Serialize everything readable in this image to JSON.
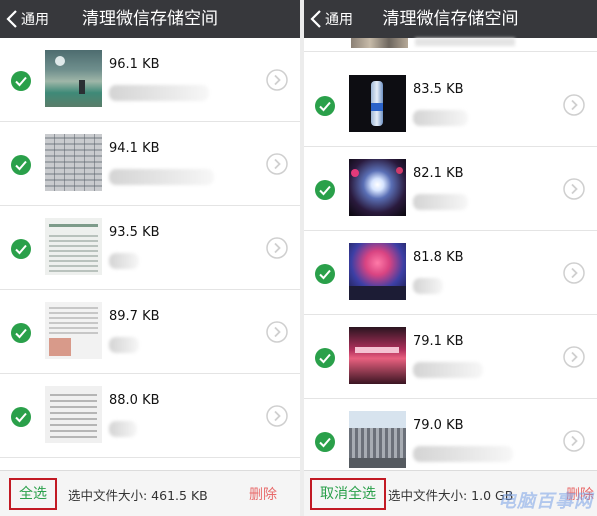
{
  "colors": {
    "header_bg": "#37383c",
    "check_green": "#2aa04a",
    "delete_red": "#e86a6a",
    "highlight_border": "#c21a24"
  },
  "left": {
    "back_label": "通用",
    "title": "清理微信存储空间",
    "items": [
      {
        "size": "96.1 KB",
        "icon": "check-circle-icon"
      },
      {
        "size": "94.1 KB",
        "icon": "check-circle-icon"
      },
      {
        "size": "93.5 KB",
        "icon": "check-circle-icon"
      },
      {
        "size": "89.7 KB",
        "icon": "check-circle-icon"
      },
      {
        "size": "88.0 KB",
        "icon": "check-circle-icon"
      }
    ],
    "footer": {
      "select_all": "全选",
      "selected_size": "选中文件大小: 461.5 KB",
      "delete": "删除"
    }
  },
  "right": {
    "back_label": "通用",
    "title": "清理微信存储空间",
    "items": [
      {
        "size": "83.5 KB",
        "icon": "check-circle-icon"
      },
      {
        "size": "82.1 KB",
        "icon": "check-circle-icon"
      },
      {
        "size": "81.8 KB",
        "icon": "check-circle-icon"
      },
      {
        "size": "79.1 KB",
        "icon": "check-circle-icon"
      },
      {
        "size": "79.0 KB",
        "icon": "check-circle-icon"
      }
    ],
    "footer": {
      "deselect_all": "取消全选",
      "selected_size": "选中文件大小: 1.0 GB",
      "delete": "删除"
    }
  },
  "watermark": "电脑百事网"
}
